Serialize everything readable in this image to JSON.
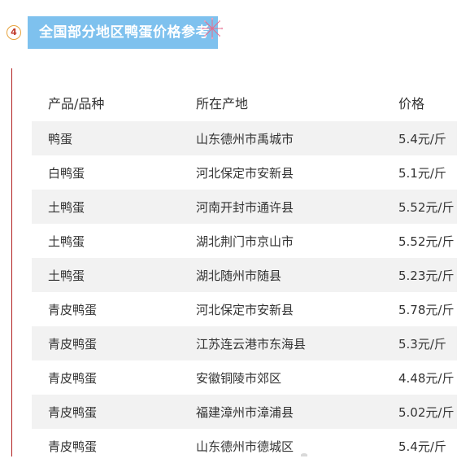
{
  "section": {
    "number": "4",
    "title": "全国部分地区鸭蛋价格参考"
  },
  "table": {
    "headers": [
      "产品/品种",
      "所在产地",
      "价格"
    ],
    "rows": [
      {
        "product": "鸭蛋",
        "origin": "山东德州市禹城市",
        "price": "5.4元/斤"
      },
      {
        "product": "白鸭蛋",
        "origin": "河北保定市安新县",
        "price": "5.1元/斤"
      },
      {
        "product": "土鸭蛋",
        "origin": "河南开封市通许县",
        "price": "5.52元/斤"
      },
      {
        "product": "土鸭蛋",
        "origin": "湖北荆门市京山市",
        "price": "5.52元/斤"
      },
      {
        "product": "土鸭蛋",
        "origin": "湖北随州市随县",
        "price": "5.23元/斤"
      },
      {
        "product": "青皮鸭蛋",
        "origin": "河北保定市安新县",
        "price": "5.78元/斤"
      },
      {
        "product": "青皮鸭蛋",
        "origin": "江苏连云港市东海县",
        "price": "5.3元/斤"
      },
      {
        "product": "青皮鸭蛋",
        "origin": "安徽铜陵市郊区",
        "price": "4.48元/斤"
      },
      {
        "product": "青皮鸭蛋",
        "origin": "福建漳州市漳浦县",
        "price": "5.02元/斤"
      },
      {
        "product": "青皮鸭蛋",
        "origin": "山东德州市德城区",
        "price": "5.4元/斤"
      }
    ]
  },
  "colors": {
    "title_bg": "#7ec1ee",
    "title_text": "#ffffff",
    "row_stripe": "#f2f2f2",
    "left_rule": "#b22222",
    "badge_border": "#e6a23c"
  },
  "icons": {
    "decoration": "firework-icon"
  }
}
